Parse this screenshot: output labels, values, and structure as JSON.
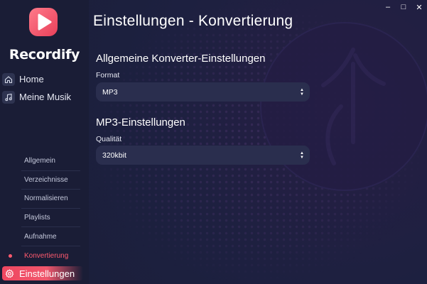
{
  "app": {
    "name": "Recordify",
    "accent": "#ef4760"
  },
  "sidebar": {
    "nav": [
      {
        "label": "Home",
        "icon": "home-icon"
      },
      {
        "label": "Meine Musik",
        "icon": "music-note-icon"
      }
    ],
    "settings_sections": [
      {
        "label": "Allgemein",
        "active": false
      },
      {
        "label": "Verzeichnisse",
        "active": false
      },
      {
        "label": "Normalisieren",
        "active": false
      },
      {
        "label": "Playlists",
        "active": false
      },
      {
        "label": "Aufnahme",
        "active": false
      },
      {
        "label": "Konvertierung",
        "active": true
      }
    ],
    "settings_button": {
      "label": "Einstellungen",
      "icon": "gear-icon"
    }
  },
  "main": {
    "title": "Einstellungen - Konvertierung",
    "general": {
      "heading": "Allgemeine Konverter-Einstellungen",
      "format_label": "Format",
      "format_value": "MP3"
    },
    "mp3": {
      "heading": "MP3-Einstellungen",
      "quality_label": "Qualität",
      "quality_value": "320kbit"
    }
  },
  "window": {
    "minimize": "–",
    "maximize": "□",
    "close": "✕"
  }
}
